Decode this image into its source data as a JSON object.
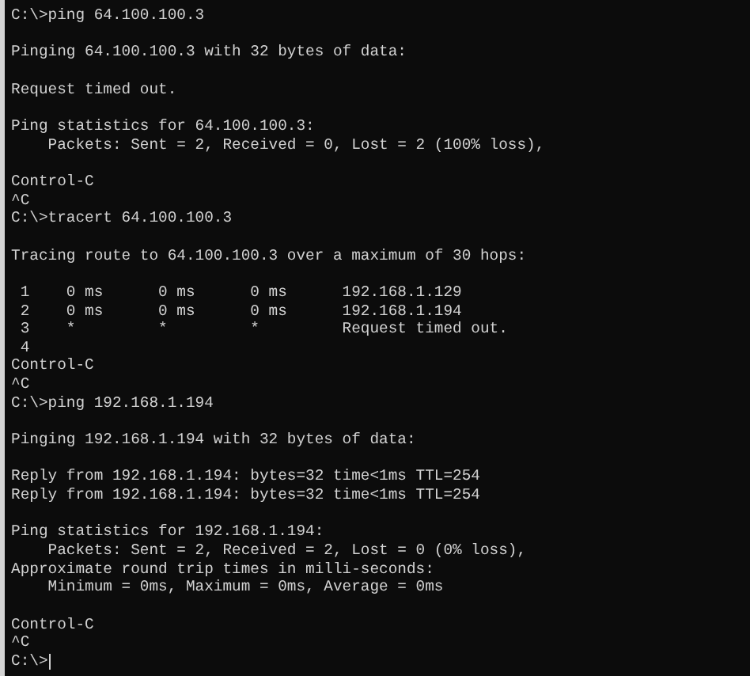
{
  "terminal": {
    "cursor_visible": true,
    "blocks": [
      [
        "C:\\>ping 64.100.100.3"
      ],
      [
        "Pinging 64.100.100.3 with 32 bytes of data:"
      ],
      [
        "Request timed out."
      ],
      [
        "Ping statistics for 64.100.100.3:",
        "    Packets: Sent = 2, Received = 0, Lost = 2 (100% loss),"
      ],
      [
        "Control-C",
        "^C",
        "C:\\>tracert 64.100.100.3"
      ],
      [
        "Tracing route to 64.100.100.3 over a maximum of 30 hops:"
      ],
      [
        " 1    0 ms      0 ms      0 ms      192.168.1.129",
        " 2    0 ms      0 ms      0 ms      192.168.1.194",
        " 3    *         *         *         Request timed out.",
        " 4",
        "Control-C",
        "^C",
        "C:\\>ping 192.168.1.194"
      ],
      [
        "Pinging 192.168.1.194 with 32 bytes of data:"
      ],
      [
        "Reply from 192.168.1.194: bytes=32 time<1ms TTL=254",
        "Reply from 192.168.1.194: bytes=32 time<1ms TTL=254"
      ],
      [
        "Ping statistics for 192.168.1.194:",
        "    Packets: Sent = 2, Received = 2, Lost = 0 (0% loss),",
        "Approximate round trip times in milli-seconds:",
        "    Minimum = 0ms, Maximum = 0ms, Average = 0ms"
      ],
      [
        "Control-C",
        "^C",
        "C:\\>"
      ]
    ]
  }
}
